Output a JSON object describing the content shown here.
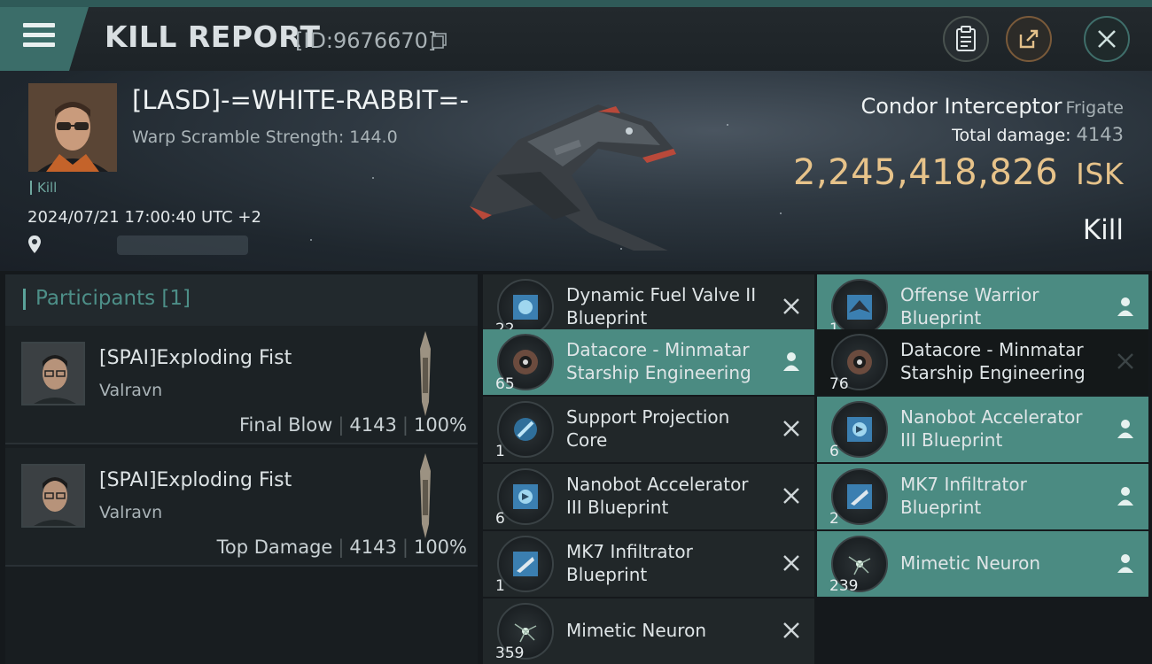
{
  "header": {
    "title": "KILL REPORT",
    "report_id": "[ID:9676670]"
  },
  "victim": {
    "pilot_name": "[LASD]-=WHITE-RABBIT=-",
    "warp_scramble": "Warp Scramble Strength: 144.0",
    "kill_tag": "Kill",
    "datetime": "2024/07/21 17:00:40 UTC +2",
    "ship_name": "Condor Interceptor",
    "ship_class": "Frigate",
    "total_damage_label": "Total damage:",
    "total_damage_value": "4143",
    "isk_value": "2,245,418,826",
    "isk_unit": "ISK",
    "result": "Kill"
  },
  "participants": {
    "label": "Participants [1]",
    "rows": [
      {
        "name": "[SPAI]Exploding Fist",
        "ship": "Valravn",
        "role": "Final Blow",
        "damage": "4143",
        "percent": "100%"
      },
      {
        "name": "[SPAI]Exploding Fist",
        "ship": "Valravn",
        "role": "Top Damage",
        "damage": "4143",
        "percent": "100%"
      }
    ]
  },
  "items_left": [
    {
      "qty": "22",
      "line1": "Dynamic Fuel Valve II",
      "line2": "Blueprint",
      "status": "destroyed",
      "icon": "module-blueprint-icon"
    },
    {
      "qty": "65",
      "line1": "Datacore - Minmatar",
      "line2": "Starship Engineering",
      "status": "dropped",
      "icon": "datacore-icon"
    },
    {
      "qty": "1",
      "line1": "Support Projection",
      "line2": "Core",
      "status": "destroyed",
      "icon": "core-icon"
    },
    {
      "qty": "6",
      "line1": "Nanobot Accelerator",
      "line2": "III Blueprint",
      "status": "destroyed",
      "icon": "module-blueprint-icon"
    },
    {
      "qty": "1",
      "line1": "MK7 Infiltrator",
      "line2": "Blueprint",
      "status": "destroyed",
      "icon": "ship-blueprint-icon"
    },
    {
      "qty": "359",
      "line1": "Mimetic Neuron",
      "line2": "",
      "status": "destroyed",
      "icon": "neuron-icon"
    }
  ],
  "items_right": [
    {
      "qty": "1",
      "line1": "Offense Warrior",
      "line2": "Blueprint",
      "status": "dropped",
      "icon": "drone-blueprint-icon"
    },
    {
      "qty": "76",
      "line1": "Datacore - Minmatar",
      "line2": "Starship Engineering",
      "status": "destroyed",
      "icon": "datacore-icon"
    },
    {
      "qty": "6",
      "line1": "Nanobot Accelerator",
      "line2": "III Blueprint",
      "status": "dropped",
      "icon": "module-blueprint-icon"
    },
    {
      "qty": "2",
      "line1": "MK7 Infiltrator",
      "line2": "Blueprint",
      "status": "dropped",
      "icon": "ship-blueprint-icon"
    },
    {
      "qty": "239",
      "line1": "Mimetic Neuron",
      "line2": "",
      "status": "dropped",
      "icon": "neuron-icon"
    }
  ],
  "colors": {
    "accent": "#4b8b82",
    "isk_gold": "#e7c38a",
    "header_teal": "#3b6d69"
  }
}
